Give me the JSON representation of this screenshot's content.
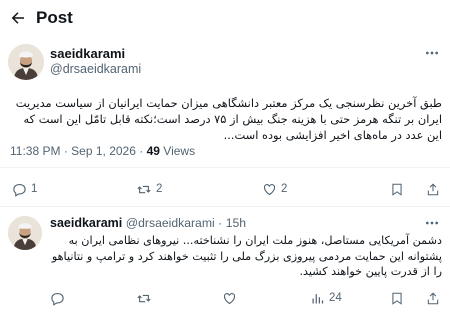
{
  "header": {
    "title": "Post"
  },
  "tweet": {
    "display_name": "saeidkarami",
    "handle": "@drsaeidkarami",
    "text": "طبق آخرین نظرسنجی یک مرکز معتبر دانشگاهی میزان حمایت ایرانیان از سیاست مدیریت ایران بر تنگه هرمز حتی با هزینه جنگ بیش از ۷۵ درصد است؛نکته قابل تامّل این است که این عدد در ماه‌های اخیر افزایشی بوده است...",
    "time": "11:38 PM",
    "date": "Sep 1, 2026",
    "views": "49",
    "views_label": "Views",
    "replies": "1",
    "reposts": "2",
    "likes": "2"
  },
  "reply": {
    "display_name": "saeidkarami",
    "handle": "@drsaeidkarami",
    "time": "15h",
    "text": "دشمن آمریکایی مستاصل، هنوز ملت ایران را نشناخته... نیروهای نظامی ایران به پشتوانه این حمایت مردمی پیروزی بزرگ ملی را تثبیت خواهند کرد و ترامپ و نتانیاهو را از قدرت پایین خواهند کشید.",
    "views": "24"
  },
  "icons": {
    "back": "arrow-left-icon",
    "more": "more-dots-icon",
    "reply": "comment-icon",
    "repost": "repost-icon",
    "like": "heart-icon",
    "bookmark": "bookmark-icon",
    "share": "share-icon",
    "views": "analytics-icon"
  },
  "colors": {
    "text": "#0f1419",
    "secondary": "#536471",
    "divider": "#eff3f4"
  }
}
